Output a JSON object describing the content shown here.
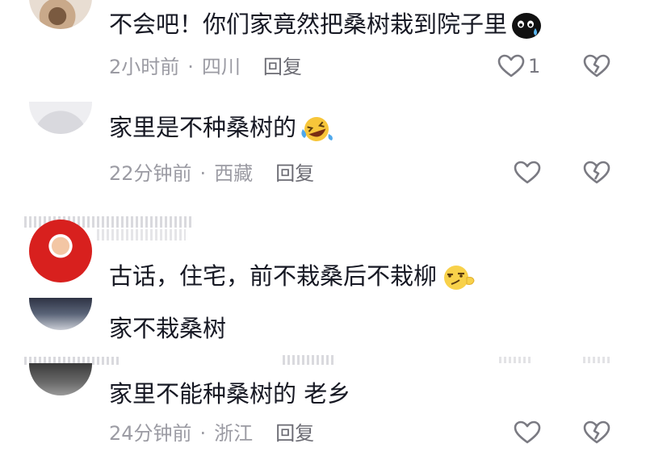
{
  "comments": [
    {
      "text": "不会吧！你们家竟然把桑树栽到院子里",
      "time": "2小时前",
      "location": "四川",
      "reply_label": "回复",
      "likes": "1"
    },
    {
      "text": "家里是不种桑树的",
      "time": "22分钟前",
      "location": "西藏",
      "reply_label": "回复"
    },
    {
      "text": "古话，住宅，前不栽桑后不栽柳"
    },
    {
      "text": "家不栽桑树"
    },
    {
      "text": "家里不能种桑树的 老乡",
      "time": "24分钟前",
      "location": "浙江",
      "reply_label": "回复"
    }
  ],
  "separator": "·",
  "icons": {
    "like": "heart-outline-icon",
    "dislike": "broken-heart-icon",
    "emoji_sweat": "sweat-face-emoji",
    "emoji_laugh": "laughing-tears-emoji",
    "emoji_smirk": "smirk-face-emoji"
  }
}
